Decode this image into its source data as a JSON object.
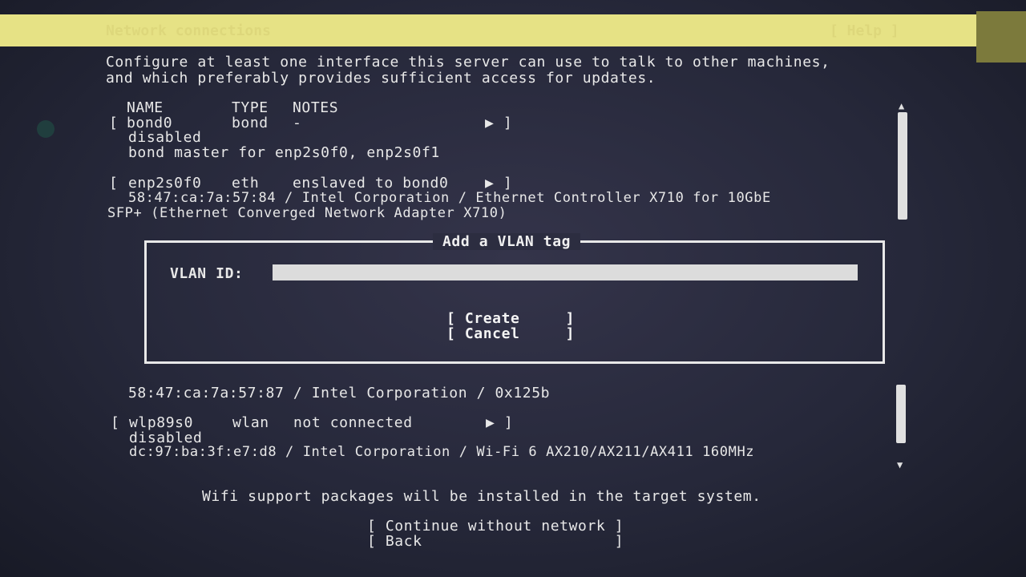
{
  "header": {
    "title": "Network connections",
    "help": "[ Help ]"
  },
  "intro": {
    "line1": "Configure at least one interface this server can use to talk to other machines,",
    "line2": "and which preferably provides sufficient access for updates."
  },
  "table": {
    "col_name": "NAME",
    "col_type": "TYPE",
    "col_notes": "NOTES"
  },
  "interfaces": [
    {
      "open": "[",
      "name": "bond0",
      "type": "bond",
      "notes": "-",
      "arrow": "▶ ]",
      "status": "disabled",
      "detail": "bond master for enp2s0f0, enp2s0f1"
    },
    {
      "open": "[",
      "name": "enp2s0f0",
      "type": "eth",
      "notes": "enslaved to bond0",
      "arrow": "▶ ]",
      "detail": "58:47:ca:7a:57:84 / Intel Corporation / Ethernet Controller X710 for 10GbE",
      "detail2": "SFP+ (Ethernet Converged Network Adapter X710)"
    },
    {
      "detail": "58:47:ca:7a:57:87 / Intel Corporation / 0x125b"
    },
    {
      "open": "[",
      "name": "wlp89s0",
      "type": "wlan",
      "notes": "not connected",
      "arrow": "▶ ]",
      "status": "disabled",
      "detail": "dc:97:ba:3f:e7:d8 / Intel Corporation / Wi-Fi 6 AX210/AX211/AX411 160MHz"
    }
  ],
  "dialog": {
    "title": "Add a VLAN tag",
    "vlan_label": "VLAN ID:",
    "vlan_value": "",
    "create": "[ Create     ]",
    "cancel": "[ Cancel     ]"
  },
  "wifi_note": "Wifi support packages will be installed in the target system.",
  "footer": {
    "continue": "[ Continue without network ]",
    "back": "[ Back                     ]"
  },
  "colors": {
    "header_bg": "#e6e285",
    "background": "#2a2b3d",
    "text": "#e8e8e8"
  }
}
